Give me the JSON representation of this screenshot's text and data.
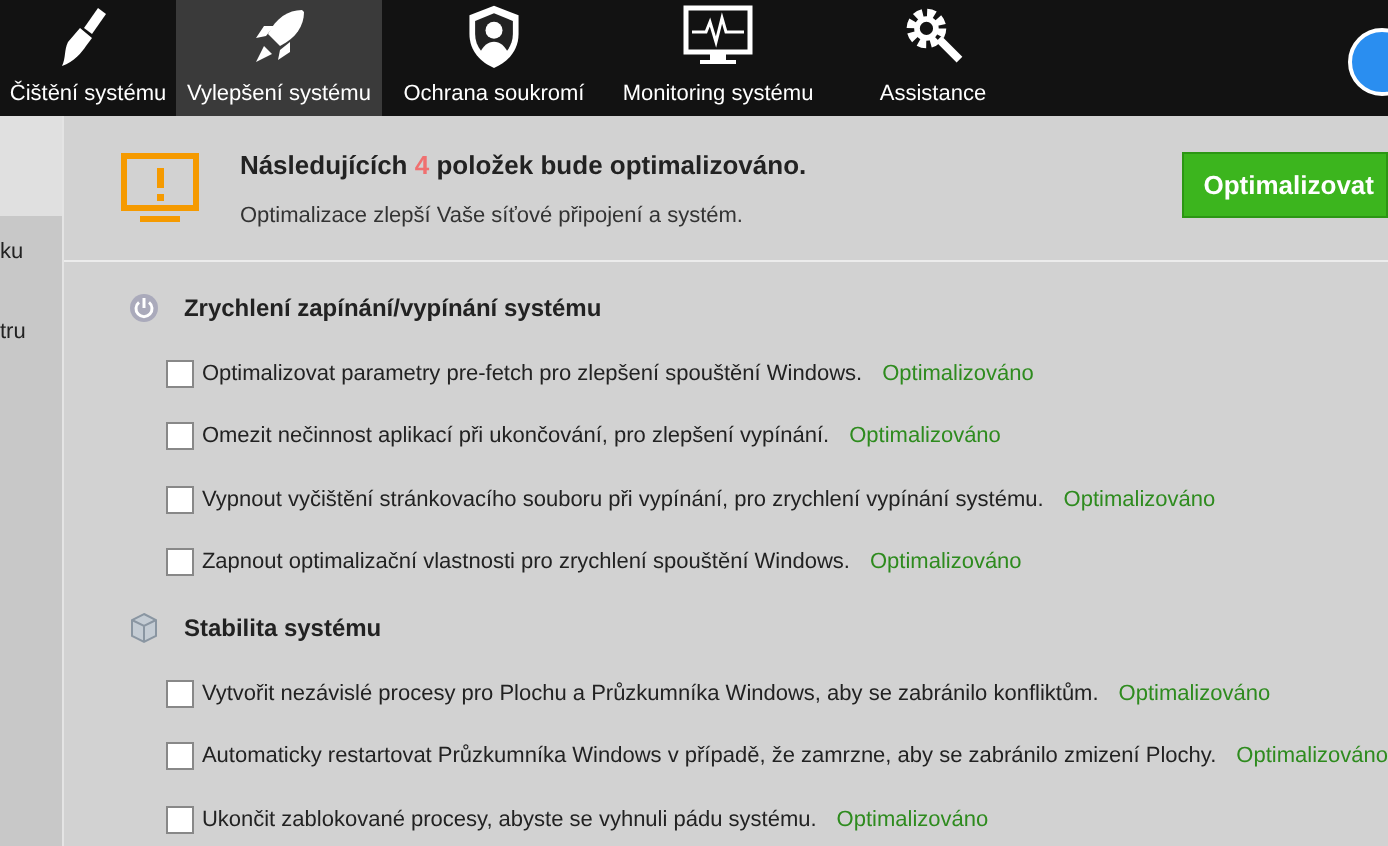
{
  "nav_tabs": [
    {
      "label": "Čištění systému",
      "selected": false
    },
    {
      "label": "Vylepšení systému",
      "selected": true
    },
    {
      "label": "Ochrana soukromí",
      "selected": false
    },
    {
      "label": "Monitoring systému",
      "selected": false
    },
    {
      "label": "Assistance",
      "selected": false
    }
  ],
  "sidebar": {
    "items": [
      {
        "selected": true
      },
      {
        "label": "ku",
        "selected": false
      },
      {
        "label": "tru",
        "selected": false
      }
    ]
  },
  "header": {
    "title_prefix": "Následujících",
    "count": "4",
    "title_suffix": "položek bude optimalizováno.",
    "subtitle": "Optimalizace zlepší Vaše síťové připojení a systém.",
    "button": "Optimalizovat"
  },
  "sections": [
    {
      "title": "Zrychlení zapínání/vypínání systému",
      "items": [
        {
          "text": "Optimalizovat parametry pre-fetch pro zlepšení spouštění Windows.",
          "status": "Optimalizováno",
          "checked": false
        },
        {
          "text": "Omezit nečinnost aplikací při ukončování, pro zlepšení vypínání.",
          "status": "Optimalizováno",
          "checked": false
        },
        {
          "text": "Vypnout vyčištění stránkovacího souboru při vypínání, pro zrychlení vypínání systému.",
          "status": "Optimalizováno",
          "checked": false
        },
        {
          "text": "Zapnout optimalizační vlastnosti pro zrychlení spouštění Windows.",
          "status": "Optimalizováno",
          "checked": false
        }
      ]
    },
    {
      "title": "Stabilita systému",
      "items": [
        {
          "text": "Vytvořit nezávislé procesy pro Plochu a Průzkumníka Windows, aby se zabránilo konfliktům.",
          "status": "Optimalizováno",
          "checked": false
        },
        {
          "text": "Automaticky restartovat Průzkumníka Windows v případě, že zamrzne, aby se zabránilo zmizení Plochy.",
          "status": "Optimalizováno",
          "checked": false
        },
        {
          "text": "Ukončit zablokované procesy, abyste se vyhnuli pádu systému.",
          "status": "Optimalizováno",
          "checked": false
        }
      ]
    }
  ]
}
